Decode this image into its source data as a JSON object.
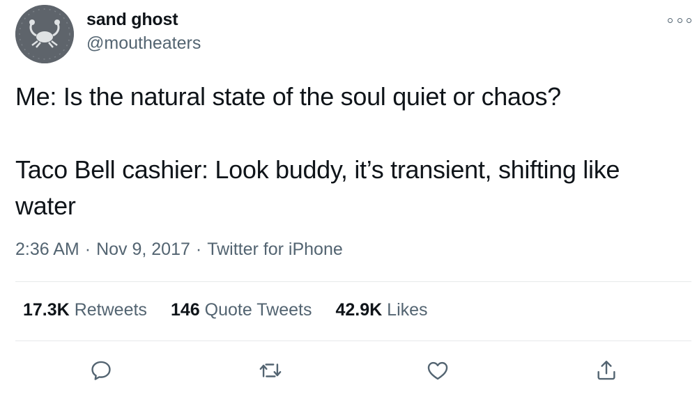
{
  "user": {
    "display_name": "sand ghost",
    "handle": "@moutheaters",
    "avatar_icon": "crab-icon"
  },
  "tweet": {
    "lines": [
      "Me: Is the natural state of the soul quiet or chaos?",
      "Taco Bell cashier: Look buddy, it’s transient, shifting like",
      "water"
    ]
  },
  "meta": {
    "time": "2:36 AM",
    "date": "Nov 9, 2017",
    "source": "Twitter for iPhone",
    "separator": "·"
  },
  "stats": {
    "retweets_count": "17.3K",
    "retweets_label": "Retweets",
    "quotes_count": "146",
    "quotes_label": "Quote Tweets",
    "likes_count": "42.9K",
    "likes_label": "Likes"
  },
  "actions": [
    "reply-icon",
    "retweet-icon",
    "like-icon",
    "share-icon"
  ],
  "colors": {
    "text": "#0f1419",
    "secondary": "#536471",
    "divider": "#e7e9ea"
  }
}
